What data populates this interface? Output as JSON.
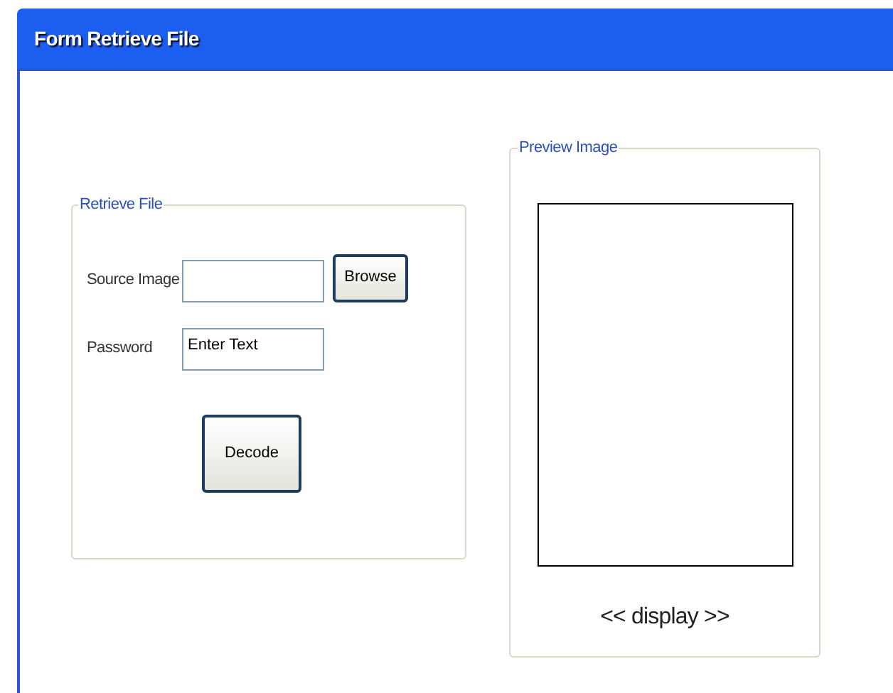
{
  "window": {
    "title": "Form Retrieve File"
  },
  "retrieve_group": {
    "legend": "Retrieve File",
    "fields": [
      {
        "label": "Source Image"
      },
      {
        "label": "Password",
        "value": "Enter Text"
      }
    ],
    "browse_button": "Browse",
    "decode_button": "Decode"
  },
  "preview_group": {
    "legend": "Preview Image",
    "caption": "<< display >>"
  }
}
